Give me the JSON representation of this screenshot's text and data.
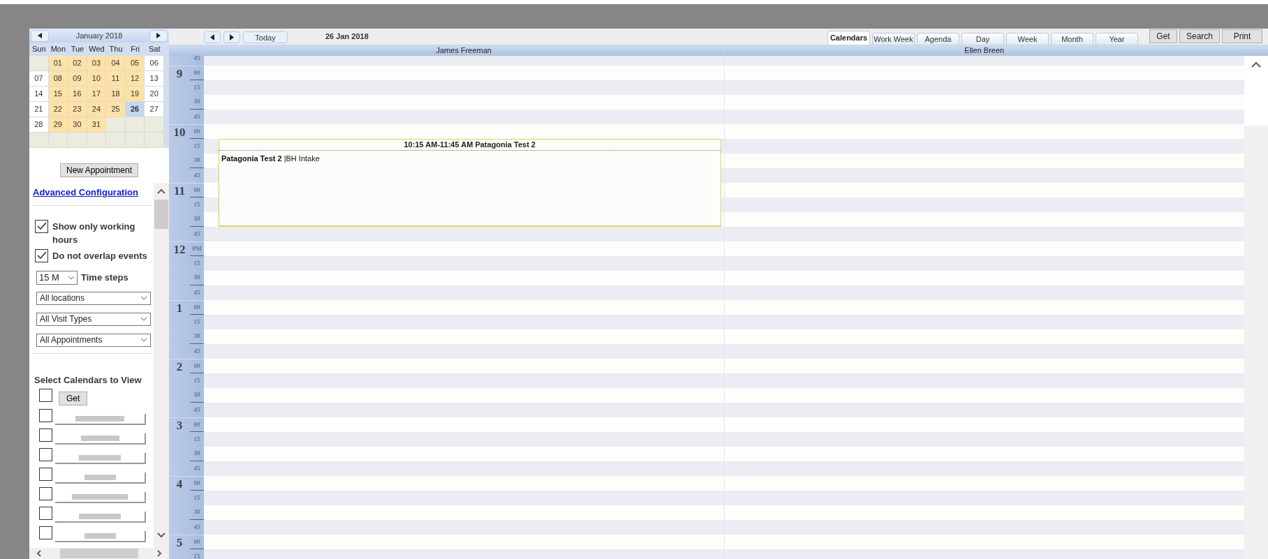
{
  "mini_calendar": {
    "title": "January 2018",
    "weekdays": [
      "Sun",
      "Mon",
      "Tue",
      "Wed",
      "Thu",
      "Fri",
      "Sat"
    ],
    "weeks": [
      [
        {
          "kind": "empty"
        },
        {
          "day": "01",
          "kind": "workday"
        },
        {
          "day": "02",
          "kind": "workday"
        },
        {
          "day": "03",
          "kind": "workday"
        },
        {
          "day": "04",
          "kind": "workday"
        },
        {
          "day": "05",
          "kind": "workday"
        },
        {
          "day": "06",
          "kind": "weekend"
        }
      ],
      [
        {
          "day": "07",
          "kind": "weekend"
        },
        {
          "day": "08",
          "kind": "workday"
        },
        {
          "day": "09",
          "kind": "workday"
        },
        {
          "day": "10",
          "kind": "workday"
        },
        {
          "day": "11",
          "kind": "workday"
        },
        {
          "day": "12",
          "kind": "workday"
        },
        {
          "day": "13",
          "kind": "weekend"
        }
      ],
      [
        {
          "day": "14",
          "kind": "weekend"
        },
        {
          "day": "15",
          "kind": "workday"
        },
        {
          "day": "16",
          "kind": "workday"
        },
        {
          "day": "17",
          "kind": "workday"
        },
        {
          "day": "18",
          "kind": "workday"
        },
        {
          "day": "19",
          "kind": "workday"
        },
        {
          "day": "20",
          "kind": "weekend"
        }
      ],
      [
        {
          "day": "21",
          "kind": "weekend"
        },
        {
          "day": "22",
          "kind": "workday"
        },
        {
          "day": "23",
          "kind": "workday"
        },
        {
          "day": "24",
          "kind": "workday"
        },
        {
          "day": "25",
          "kind": "workday"
        },
        {
          "day": "26",
          "kind": "selected"
        },
        {
          "day": "27",
          "kind": "weekend"
        }
      ],
      [
        {
          "day": "28",
          "kind": "weekend"
        },
        {
          "day": "29",
          "kind": "workday"
        },
        {
          "day": "30",
          "kind": "workday"
        },
        {
          "day": "31",
          "kind": "workday"
        },
        {
          "kind": "empty"
        },
        {
          "kind": "empty"
        },
        {
          "kind": "empty"
        }
      ],
      [
        {
          "kind": "empty"
        },
        {
          "kind": "empty"
        },
        {
          "kind": "empty"
        },
        {
          "kind": "empty"
        },
        {
          "kind": "empty"
        },
        {
          "kind": "empty"
        },
        {
          "kind": "empty"
        }
      ]
    ]
  },
  "new_appointment_button": "New Appointment",
  "advanced_configuration_link": "Advanced Configuration",
  "options": [
    {
      "label": "Show only working hours",
      "checked": true
    },
    {
      "label": "Do not overlap events",
      "checked": true
    }
  ],
  "time_steps": {
    "value": "15 M",
    "label": "Time steps"
  },
  "filters": [
    "All locations",
    "All Visit Types",
    "All Appointments"
  ],
  "select_calendars": {
    "title": "Select Calendars to View",
    "all_checked": false,
    "get_button": "Get",
    "calendars": [
      {
        "checked": false
      },
      {
        "checked": false
      },
      {
        "checked": false
      },
      {
        "checked": false
      },
      {
        "checked": false
      },
      {
        "checked": false
      },
      {
        "checked": false
      }
    ]
  },
  "toolbar": {
    "today_button": "Today",
    "date": "26 Jan 2018",
    "views": [
      {
        "label": "Calendars",
        "selected": true
      },
      {
        "label": "Work Week",
        "selected": false
      },
      {
        "label": "Agenda",
        "selected": false
      },
      {
        "label": "Day",
        "selected": false
      },
      {
        "label": "Week",
        "selected": false
      },
      {
        "label": "Month",
        "selected": false
      },
      {
        "label": "Year",
        "selected": false
      }
    ],
    "buttons": [
      "Get",
      "Search",
      "Print"
    ]
  },
  "time_slots": [
    {
      "minute": "45"
    },
    {
      "hour": "9",
      "minute": "00"
    },
    {
      "minute": "15"
    },
    {
      "minute": "30"
    },
    {
      "minute": "45"
    },
    {
      "hour": "10",
      "minute": "00"
    },
    {
      "minute": "15"
    },
    {
      "minute": "30"
    },
    {
      "minute": "45"
    },
    {
      "hour": "11",
      "minute": "00"
    },
    {
      "minute": "15"
    },
    {
      "minute": "30"
    },
    {
      "minute": "45"
    },
    {
      "hour": "12",
      "minute": "PM"
    },
    {
      "minute": "15"
    },
    {
      "minute": "30"
    },
    {
      "minute": "45"
    },
    {
      "hour": "1",
      "minute": "00"
    },
    {
      "minute": "15"
    },
    {
      "minute": "30"
    },
    {
      "minute": "45"
    },
    {
      "hour": "2",
      "minute": "00"
    },
    {
      "minute": "15"
    },
    {
      "minute": "30"
    },
    {
      "minute": "45"
    },
    {
      "hour": "3",
      "minute": "00"
    },
    {
      "minute": "15"
    },
    {
      "minute": "30"
    },
    {
      "minute": "45"
    },
    {
      "hour": "4",
      "minute": "00"
    },
    {
      "minute": "15"
    },
    {
      "minute": "30"
    },
    {
      "minute": "45"
    },
    {
      "hour": "5",
      "minute": "00"
    },
    {
      "minute": "15"
    }
  ],
  "columns": [
    {
      "name": "James Freeman",
      "events": [
        {
          "header": "10:15 AM-11:45 AM Patagonia Test 2",
          "body": "**Patagonia Test 2** |BH Intake"
        }
      ]
    },
    {
      "name": "Ellen Breen"
    }
  ]
}
